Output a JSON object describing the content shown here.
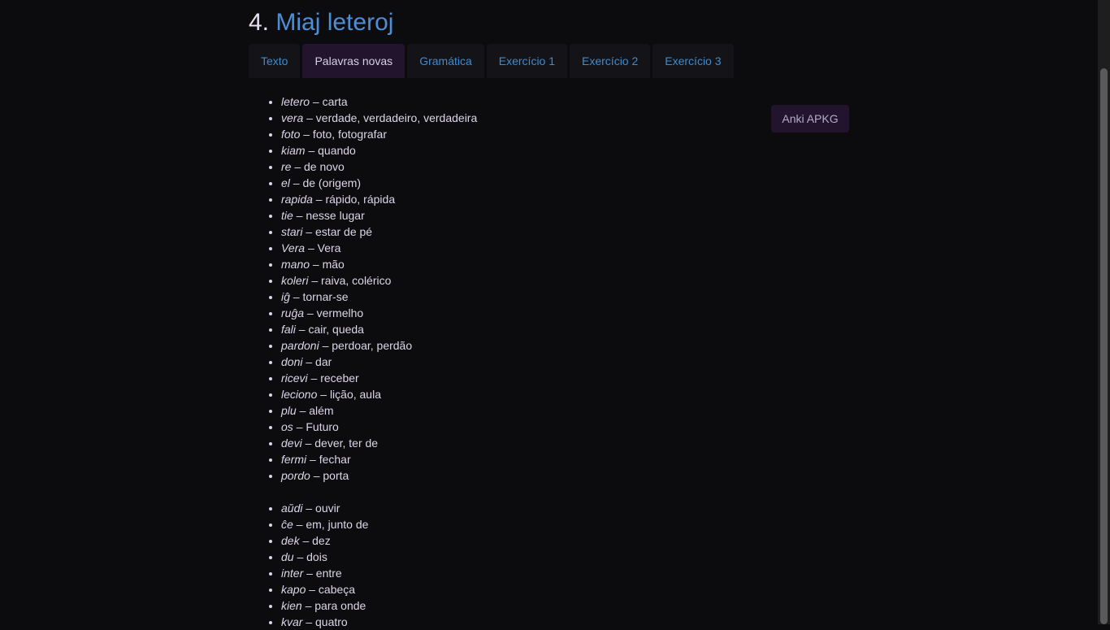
{
  "heading": {
    "number": "4.",
    "name": "Miaj leteroj"
  },
  "tabs": [
    {
      "label": "Texto",
      "active": false
    },
    {
      "label": "Palavras novas",
      "active": true
    },
    {
      "label": "Gramática",
      "active": false
    },
    {
      "label": "Exercício 1",
      "active": false
    },
    {
      "label": "Exercício 2",
      "active": false
    },
    {
      "label": "Exercício 3",
      "active": false
    }
  ],
  "anki_button": "Anki APKG",
  "vocab_list_1": [
    {
      "word": "letero",
      "translation": " – carta"
    },
    {
      "word": "vera",
      "translation": " – verdade, verdadeiro, verdadeira"
    },
    {
      "word": "foto",
      "translation": " – foto, fotografar"
    },
    {
      "word": "kiam",
      "translation": " – quando"
    },
    {
      "word": "re",
      "translation": " – de novo"
    },
    {
      "word": "el",
      "translation": " – de (origem)"
    },
    {
      "word": "rapida",
      "translation": " – rápido, rápida"
    },
    {
      "word": "tie",
      "translation": " – nesse lugar"
    },
    {
      "word": "stari",
      "translation": " – estar de pé"
    },
    {
      "word": "Vera",
      "translation": " – Vera"
    },
    {
      "word": "mano",
      "translation": " – mão"
    },
    {
      "word": "koleri",
      "translation": " – raiva, colérico"
    },
    {
      "word": "iĝ",
      "translation": " – tornar-se"
    },
    {
      "word": "ruĝa",
      "translation": " – vermelho"
    },
    {
      "word": "fali",
      "translation": " – cair, queda"
    },
    {
      "word": "pardoni",
      "translation": " – perdoar, perdão"
    },
    {
      "word": "doni",
      "translation": " – dar"
    },
    {
      "word": "ricevi",
      "translation": " – receber"
    },
    {
      "word": "leciono",
      "translation": " – lição, aula"
    },
    {
      "word": "plu",
      "translation": " – além"
    },
    {
      "word": "os",
      "translation": " – Futuro"
    },
    {
      "word": "devi",
      "translation": " – dever, ter de"
    },
    {
      "word": "fermi",
      "translation": " – fechar"
    },
    {
      "word": "pordo",
      "translation": " – porta"
    }
  ],
  "vocab_list_2": [
    {
      "word": "aŭdi",
      "translation": " – ouvir"
    },
    {
      "word": "ĉe",
      "translation": " – em, junto de"
    },
    {
      "word": "dek",
      "translation": " – dez"
    },
    {
      "word": "du",
      "translation": " – dois"
    },
    {
      "word": "inter",
      "translation": " – entre"
    },
    {
      "word": "kapo",
      "translation": " – cabeça"
    },
    {
      "word": "kien",
      "translation": " – para onde"
    },
    {
      "word": "kvar",
      "translation": " – quatro"
    }
  ],
  "colors": {
    "background": "#0c0c0f",
    "link": "#4d8fd4",
    "tab_bg": "#131318",
    "tab_active_bg": "#22142c",
    "text": "#dcd6e8"
  }
}
